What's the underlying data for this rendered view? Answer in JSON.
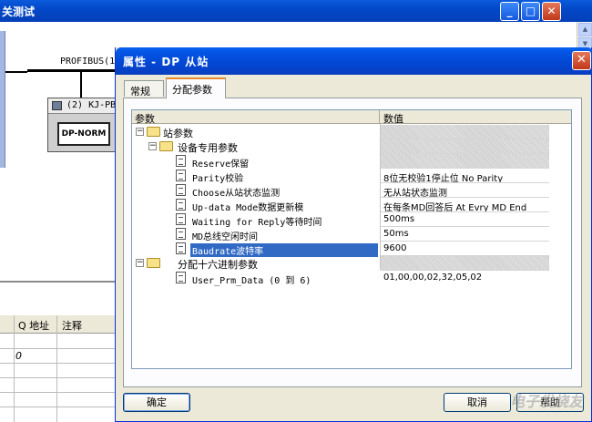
{
  "main_window": {
    "title": "关测试",
    "minimize": "_",
    "maximize": "□",
    "close": "✕",
    "profibus_label": "PROFIBUS(1",
    "station_header": "(2) KJ-PB",
    "station_box": "DP-NORM",
    "table": {
      "col_q": "Q 地址",
      "col_note": "注释",
      "cell_value": "0"
    }
  },
  "dialog": {
    "title": "属性 - DP 从站",
    "close": "✕",
    "tabs": [
      "常规",
      "分配参数"
    ],
    "grid": {
      "col_param": "参数",
      "col_value": "数值",
      "rows": [
        {
          "label": "站参数",
          "value": ""
        },
        {
          "label": "设备专用参数",
          "value": ""
        },
        {
          "label": "Reserve保留",
          "value": ""
        },
        {
          "label": "Parity校验",
          "value": "8位无校验1停止位 No Parity"
        },
        {
          "label": "Choose从站状态监测",
          "value": "无从站状态监测"
        },
        {
          "label": "Up-data Mode数据更新模",
          "value": "在每条MD回答后 At Evry MD End"
        },
        {
          "label": "Waiting for Reply等待时间",
          "value": "500ms"
        },
        {
          "label": "MD总线空闲时间",
          "value": "50ms"
        },
        {
          "label": "Baudrate波特率",
          "value": "9600"
        },
        {
          "label": "分配十六进制参数",
          "value": ""
        },
        {
          "label": "User_Prm_Data (0 到 6)",
          "value": "01,00,00,02,32,05,02"
        }
      ]
    },
    "buttons": {
      "ok": "确定",
      "cancel": "取消",
      "help": "帮助"
    }
  },
  "watermark": "电子发烧友",
  "colors": {
    "title_blue": "#0348c8",
    "selection": "#316ac5",
    "close_red": "#c0381a",
    "tab_highlight": "#e68b2c"
  }
}
